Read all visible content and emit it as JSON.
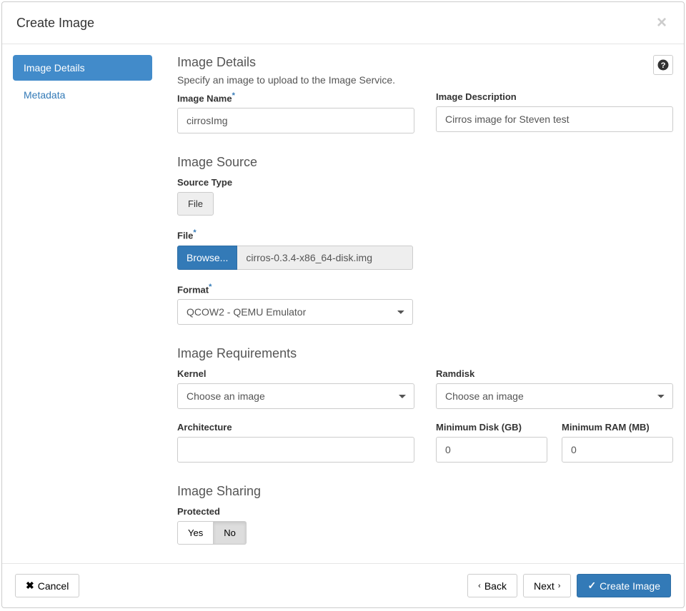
{
  "modal": {
    "title": "Create Image"
  },
  "sidebar": {
    "items": [
      {
        "label": "Image Details",
        "active": true
      },
      {
        "label": "Metadata",
        "active": false
      }
    ]
  },
  "sections": {
    "details_title": "Image Details",
    "details_subtitle": "Specify an image to upload to the Image Service.",
    "source_title": "Image Source",
    "requirements_title": "Image Requirements",
    "sharing_title": "Image Sharing"
  },
  "fields": {
    "image_name": {
      "label": "Image Name",
      "value": "cirrosImg"
    },
    "image_description": {
      "label": "Image Description",
      "value": "Cirros image for Steven test"
    },
    "source_type": {
      "label": "Source Type",
      "value": "File"
    },
    "file": {
      "label": "File",
      "browse": "Browse...",
      "filename": "cirros-0.3.4-x86_64-disk.img"
    },
    "format": {
      "label": "Format",
      "value": "QCOW2 - QEMU Emulator"
    },
    "kernel": {
      "label": "Kernel",
      "value": "Choose an image"
    },
    "ramdisk": {
      "label": "Ramdisk",
      "value": "Choose an image"
    },
    "architecture": {
      "label": "Architecture",
      "value": ""
    },
    "min_disk": {
      "label": "Minimum Disk (GB)",
      "value": "0"
    },
    "min_ram": {
      "label": "Minimum RAM (MB)",
      "value": "0"
    },
    "protected": {
      "label": "Protected",
      "yes": "Yes",
      "no": "No",
      "active": "No"
    }
  },
  "footer": {
    "cancel": "Cancel",
    "back": "Back",
    "next": "Next",
    "create": "Create Image"
  }
}
